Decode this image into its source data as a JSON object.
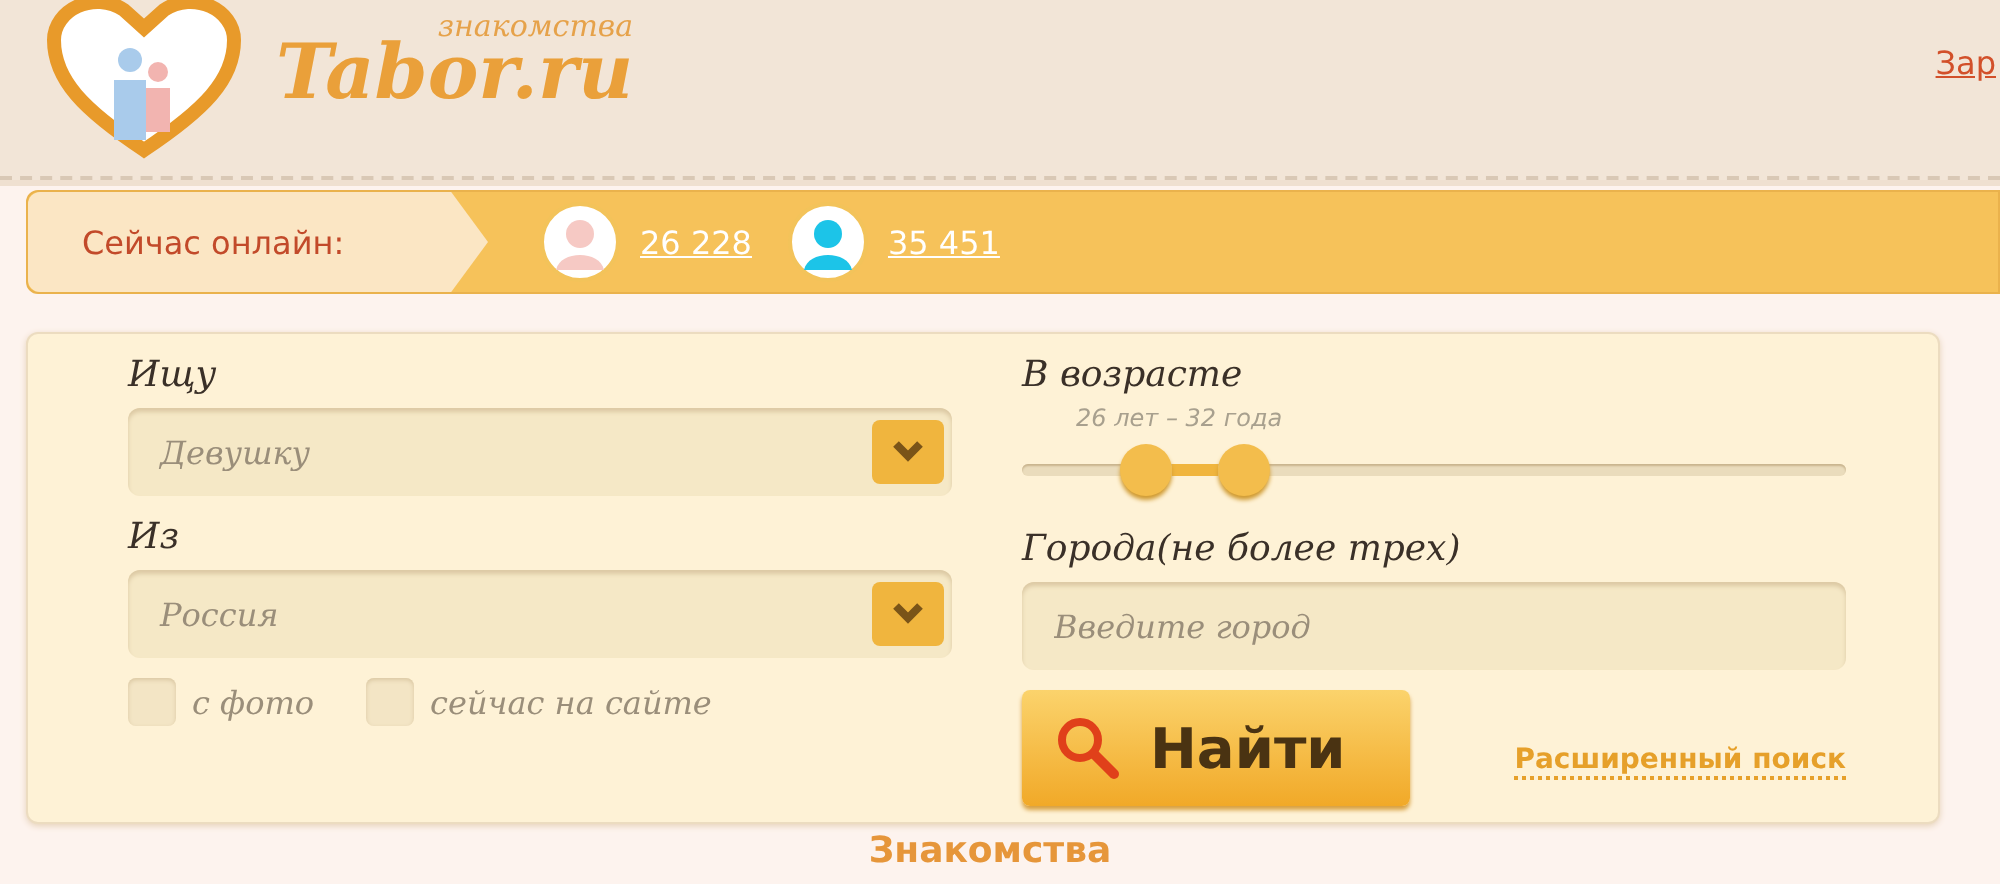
{
  "header": {
    "logo": {
      "caption": "знакомства",
      "name": "Tabor.ru"
    },
    "link": "Зар"
  },
  "online": {
    "label": "Сейчас онлайн:",
    "counters": [
      {
        "kind": "female",
        "count": "26 228"
      },
      {
        "kind": "male",
        "count": "35 451"
      }
    ]
  },
  "search": {
    "seeking": {
      "label": "Ищу",
      "value": "Девушку"
    },
    "from": {
      "label": "Из",
      "value": "Россия"
    },
    "options": [
      {
        "label": "с фото",
        "checked": false
      },
      {
        "label": "сейчас на сайте",
        "checked": false
      }
    ],
    "age": {
      "label": "В возрасте",
      "reading": "26 лет – 32 года",
      "thumbs": [
        {
          "level": 0.15
        },
        {
          "level": 0.27
        }
      ]
    },
    "cities": {
      "label": "Города(не более трех)",
      "placeholder": "Введите город"
    },
    "button": "Найти",
    "advanced_link": "Расширенный поиск"
  },
  "footer_heading": "Знакомства"
}
